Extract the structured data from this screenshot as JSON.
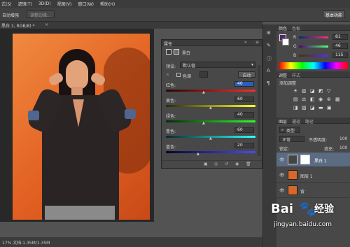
{
  "menu": {
    "items": [
      "式(S)",
      "滤镜(T)",
      "3D(D)",
      "视图(V)",
      "窗口(W)",
      "帮助(H)"
    ]
  },
  "options": {
    "label": "自动增强",
    "button1": "调整边缘...",
    "essentials": "基本功能"
  },
  "doc": {
    "tab": "黑白 1, RGB/8) *"
  },
  "properties": {
    "title": "属性",
    "adjust_label": "黑白",
    "preset_label": "预设:",
    "preset_value": "默认值",
    "tint_label": "色调",
    "auto_button": "自动",
    "sliders": [
      {
        "label": "红色:",
        "value": "40",
        "gradient": "linear-gradient(90deg,#2a0606,#ff2b2b)"
      },
      {
        "label": "黄色:",
        "value": "60",
        "gradient": "linear-gradient(90deg,#2a2a06,#ffff2b)"
      },
      {
        "label": "绿色:",
        "value": "40",
        "gradient": "linear-gradient(90deg,#062a06,#2bff2b)"
      },
      {
        "label": "青色:",
        "value": "60",
        "gradient": "linear-gradient(90deg,#062a2a,#2bffff)"
      },
      {
        "label": "蓝色:",
        "value": "20",
        "gradient": "linear-gradient(90deg,#06062a,#4a4aff)"
      }
    ]
  },
  "color_panel": {
    "tabs": [
      "颜色",
      "色板"
    ],
    "r_label": "R",
    "r_value": "81",
    "g_label": "G",
    "g_value": "46",
    "b_label": "B",
    "b_value": "115",
    "fg_color": "#51296f"
  },
  "adjust_panel": {
    "tabs": [
      "调整",
      "样式"
    ],
    "add_label": "添加调整"
  },
  "layers_panel": {
    "tabs": [
      "图层",
      "通道",
      "路径"
    ],
    "kind_label": "类型",
    "blend_mode": "正常",
    "opacity_label": "不透明度:",
    "opacity_value": "100",
    "lock_label": "锁定:",
    "fill_label": "填充:",
    "fill_value": "100",
    "layers": [
      {
        "name": "黑白 1"
      },
      {
        "name": "图层 1"
      },
      {
        "name": "背"
      }
    ]
  },
  "status": {
    "text": "17% 文档:1.35M/1.35M"
  },
  "watermark": {
    "logo": "Bai",
    "logo_cn": "经验",
    "url": "jingyan.baidu.com"
  }
}
